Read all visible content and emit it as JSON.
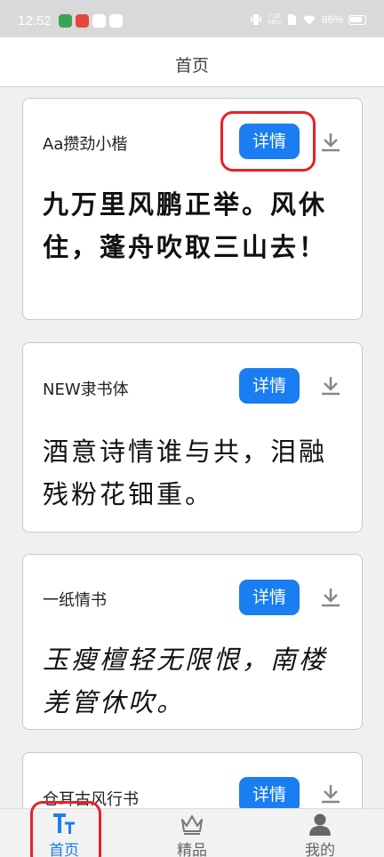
{
  "status": {
    "time": "12:52",
    "net_speed_value": "7.00",
    "net_speed_unit": "KB/s",
    "battery": "86%"
  },
  "header": {
    "title": "首页"
  },
  "cards": [
    {
      "font_name": "Aa攒劲小楷",
      "detail_label": "详情",
      "sample": "九万里风鹏正举。风休住，蓬舟吹取三山去！",
      "download_icon": "download-icon"
    },
    {
      "font_name": "NEW隶书体",
      "detail_label": "详情",
      "sample": "酒意诗情谁与共，泪融残粉花钿重。",
      "download_icon": "download-icon"
    },
    {
      "font_name": "一纸情书",
      "detail_label": "详情",
      "sample": "玉瘦檀轻无限恨，南楼羌管休吹。",
      "download_icon": "download-icon"
    },
    {
      "font_name": "仓耳古风行书",
      "detail_label": "详情",
      "sample": "",
      "download_icon": "download-icon"
    }
  ],
  "nav": {
    "items": [
      {
        "label": "首页",
        "icon": "font-size-icon",
        "active": true
      },
      {
        "label": "精品",
        "icon": "crown-icon",
        "active": false
      },
      {
        "label": "我的",
        "icon": "user-icon",
        "active": false
      }
    ]
  },
  "colors": {
    "accent": "#1a7df2",
    "highlight": "#e8202a"
  }
}
